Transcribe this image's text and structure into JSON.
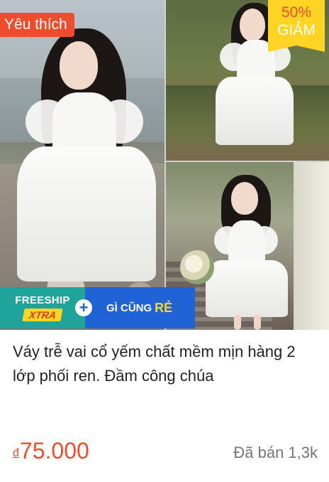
{
  "badges": {
    "favorite": "Yêu thích",
    "discount_percent": "50%",
    "discount_word": "GIẢM"
  },
  "promo": {
    "freeship_title": "FREESHIP",
    "freeship_tag": "XTRA",
    "plus": "+",
    "cheap_text": "GÌ CŨNG",
    "cheap_accent": "RẺ"
  },
  "product": {
    "title": "Váy trễ vai cổ yếm chất mềm mịn hàng 2 lớp phối ren. Đầm công chúa",
    "currency": "đ",
    "price": "75.000",
    "sold": "Đã bán 1,3k"
  },
  "colors": {
    "brand_orange": "#ee4d2d",
    "discount_yellow": "#ffd424",
    "freeship_teal": "#1fa39a",
    "promo_blue": "#1f63d6"
  }
}
